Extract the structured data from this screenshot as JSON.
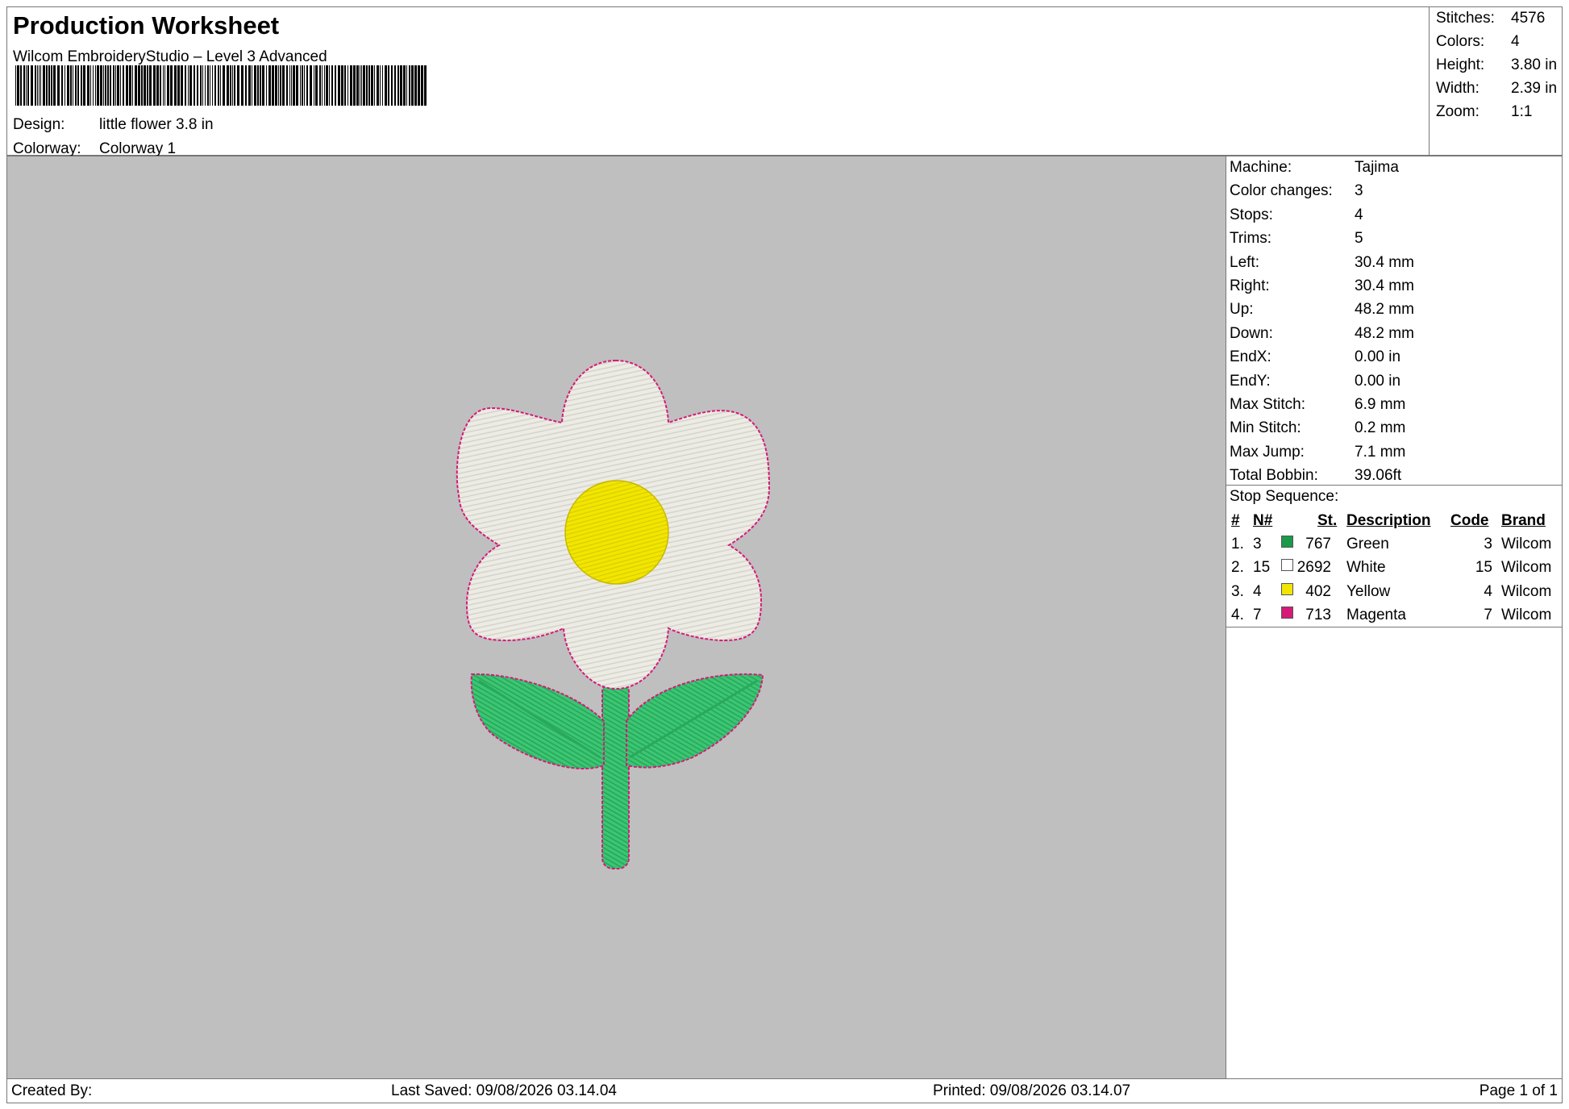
{
  "header": {
    "title": "Production Worksheet",
    "software": "Wilcom EmbroideryStudio – Level 3 Advanced",
    "design_label": "Design:",
    "design_value": "little flower 3.8 in",
    "colorway_label": "Colorway:",
    "colorway_value": "Colorway 1"
  },
  "summary": [
    {
      "label": "Stitches:",
      "value": "4576"
    },
    {
      "label": "Colors:",
      "value": "4"
    },
    {
      "label": "Height:",
      "value": "3.80 in"
    },
    {
      "label": "Width:",
      "value": "2.39 in"
    },
    {
      "label": "Zoom:",
      "value": "1:1"
    }
  ],
  "machine_stats": [
    {
      "label": "Machine:",
      "value": "Tajima"
    },
    {
      "label": "Color changes:",
      "value": "3"
    },
    {
      "label": "Stops:",
      "value": "4"
    },
    {
      "label": "Trims:",
      "value": "5"
    },
    {
      "label": "Left:",
      "value": "30.4 mm"
    },
    {
      "label": "Right:",
      "value": "30.4 mm"
    },
    {
      "label": "Up:",
      "value": "48.2 mm"
    },
    {
      "label": "Down:",
      "value": "48.2 mm"
    },
    {
      "label": "EndX:",
      "value": "0.00 in"
    },
    {
      "label": "EndY:",
      "value": "0.00 in"
    },
    {
      "label": "Max Stitch:",
      "value": "6.9 mm"
    },
    {
      "label": "Min Stitch:",
      "value": "0.2 mm"
    },
    {
      "label": "Max Jump:",
      "value": "7.1 mm"
    },
    {
      "label": "Total Bobbin:",
      "value": "39.06ft"
    }
  ],
  "stop_sequence": {
    "title": "Stop Sequence:",
    "headers": {
      "num": "#",
      "needle": "N#",
      "stitches": "St.",
      "description": "Description",
      "code": "Code",
      "brand": "Brand"
    },
    "rows": [
      {
        "num": "1.",
        "needle": "3",
        "color": "#1a9a4a",
        "stitches": "767",
        "description": "Green",
        "code": "3",
        "brand": "Wilcom"
      },
      {
        "num": "2.",
        "needle": "15",
        "color": "#ffffff",
        "stitches": "2692",
        "description": "White",
        "code": "15",
        "brand": "Wilcom"
      },
      {
        "num": "3.",
        "needle": "4",
        "color": "#f2e600",
        "stitches": "402",
        "description": "Yellow",
        "code": "4",
        "brand": "Wilcom"
      },
      {
        "num": "4.",
        "needle": "7",
        "color": "#d61a78",
        "stitches": "713",
        "description": "Magenta",
        "code": "7",
        "brand": "Wilcom"
      }
    ]
  },
  "footer": {
    "created_by": "Created By:",
    "last_saved": "Last Saved: 09/08/2026 03.14.04",
    "printed": "Printed: 09/08/2026 03.14.07",
    "page": "Page 1 of 1"
  },
  "design_colors": {
    "background": "#bfbfbf",
    "petals": "#ecece4",
    "center": "#f2e600",
    "stem_leaves": "#33c06a",
    "outline": "#d61a78"
  }
}
